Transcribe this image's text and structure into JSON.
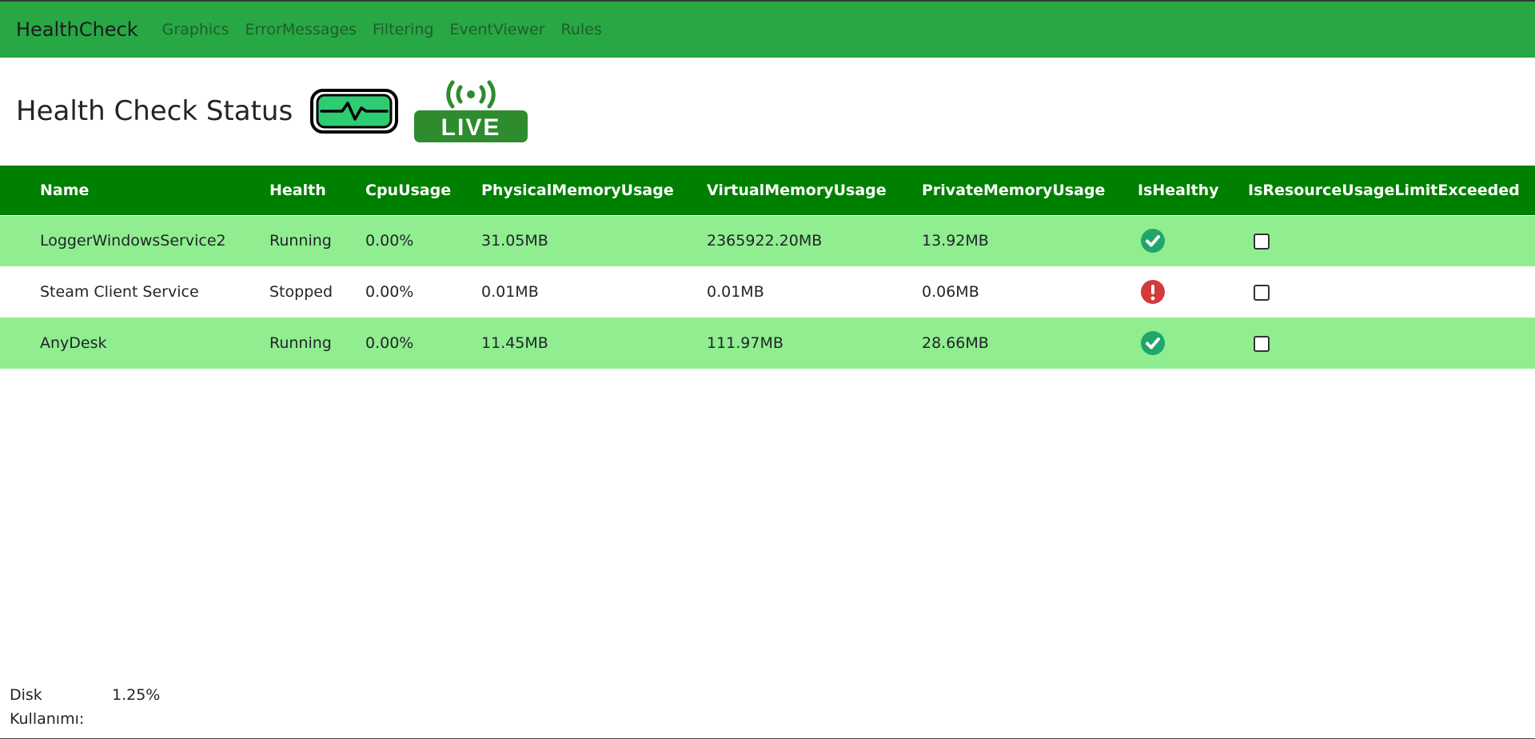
{
  "navbar": {
    "brand": "HealthCheck",
    "items": [
      {
        "label": "Graphics"
      },
      {
        "label": "ErrorMessages"
      },
      {
        "label": "Filtering"
      },
      {
        "label": "EventViewer"
      },
      {
        "label": "Rules"
      }
    ]
  },
  "page": {
    "title": "Health Check Status",
    "live_label": "LIVE"
  },
  "table": {
    "headers": [
      "Name",
      "Health",
      "CpuUsage",
      "PhysicalMemoryUsage",
      "VirtualMemoryUsage",
      "PrivateMemoryUsage",
      "IsHealthy",
      "IsResourceUsageLimitExceeded"
    ],
    "rows": [
      {
        "name": "LoggerWindowsService2",
        "health": "Running",
        "cpu": "0.00%",
        "physical": "31.05MB",
        "virtual": "2365922.20MB",
        "private": "13.92MB",
        "is_healthy": true,
        "limit_exceeded": false
      },
      {
        "name": "Steam Client Service",
        "health": "Stopped",
        "cpu": "0.00%",
        "physical": "0.01MB",
        "virtual": "0.01MB",
        "private": "0.06MB",
        "is_healthy": false,
        "limit_exceeded": false
      },
      {
        "name": "AnyDesk",
        "health": "Running",
        "cpu": "0.00%",
        "physical": "11.45MB",
        "virtual": "111.97MB",
        "private": "28.66MB",
        "is_healthy": true,
        "limit_exceeded": false
      }
    ]
  },
  "footer": {
    "disk_label": "Disk Kullanımı:",
    "disk_value": "1.25%"
  },
  "colors": {
    "navbar": "#28a745",
    "table_header": "#008000",
    "row_highlight": "#90ee90",
    "healthy": "#20a66a",
    "unhealthy": "#d23b3b"
  }
}
